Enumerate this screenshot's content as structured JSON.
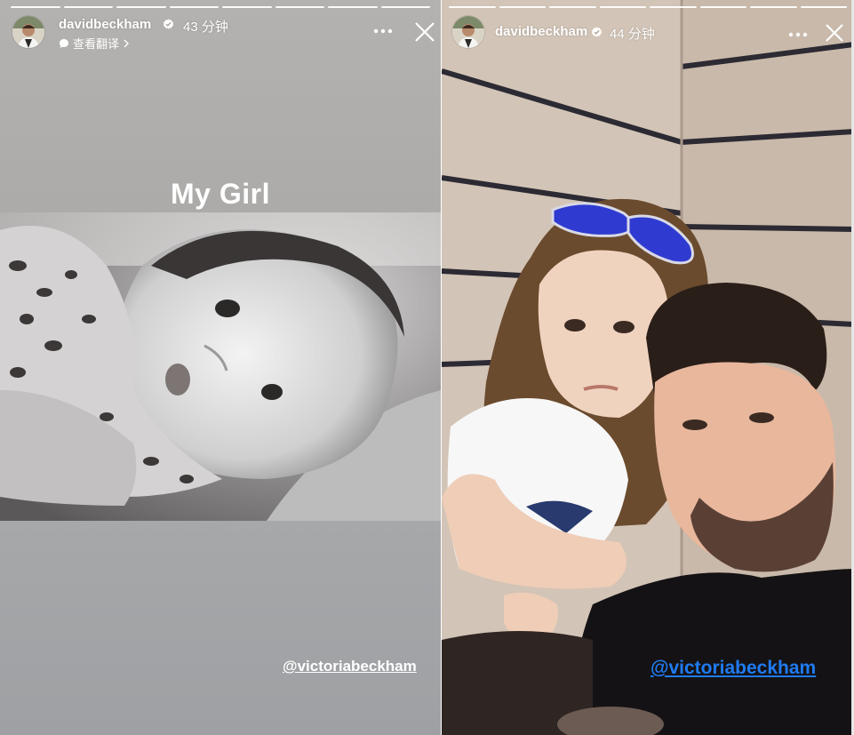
{
  "stories": [
    {
      "username": "davidbeckham",
      "time": "43 分钟",
      "translate_label": "查看翻译",
      "title": "My Girl",
      "mention": "@victoriabeckham",
      "progress_segments": 8,
      "progress_done": 8,
      "mention_color": "#ffffff"
    },
    {
      "username": "davidbeckham",
      "time": "44 分钟",
      "mention": "@victoriabeckham",
      "progress_segments": 8,
      "progress_done": 8,
      "mention_color": "#1f7bf2"
    }
  ],
  "icons": {
    "verified": "verified-badge-icon",
    "more": "more-horizontal-icon",
    "close": "close-icon",
    "translate": "speech-bubble-icon",
    "chevron": "chevron-right-icon"
  },
  "colors": {
    "accent": "#1f7bf2"
  }
}
